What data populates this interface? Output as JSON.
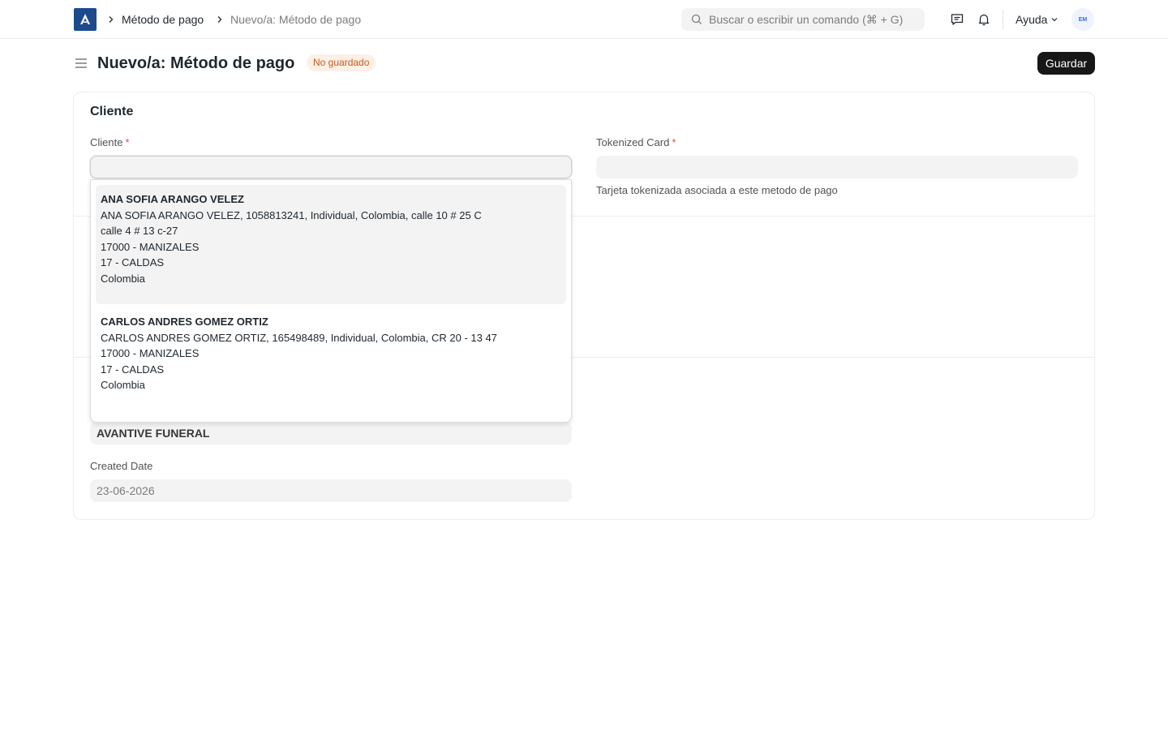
{
  "breadcrumb": {
    "items": [
      "Método de pago",
      "Nuevo/a: Método de pago"
    ]
  },
  "search": {
    "placeholder": "Buscar o escribir un comando (⌘ + G)"
  },
  "navbar": {
    "help_label": "Ayuda",
    "avatar_initials": "EM"
  },
  "page": {
    "title": "Nuevo/a: Método de pago",
    "status_badge": "No guardado",
    "save_label": "Guardar"
  },
  "form": {
    "section_title": "Cliente",
    "cliente": {
      "label": "Cliente",
      "required_mark": "*",
      "value": ""
    },
    "tokenized_card": {
      "label": "Tokenized Card",
      "required_mark": "*",
      "value": "",
      "help": "Tarjeta tokenizada asociada a este metodo de pago"
    },
    "company_value": "AVANTIVE FUNERAL",
    "created_date": {
      "label": "Created Date",
      "value": "23-06-2026"
    }
  },
  "dropdown": {
    "items": [
      {
        "name": "ANA SOFIA ARANGO VELEZ",
        "lines": [
          "ANA SOFIA ARANGO VELEZ, 1058813241, Individual, Colombia, calle 10 # 25 C",
          "calle 4 # 13 c-27",
          "17000 - MANIZALES",
          "17 - CALDAS",
          "Colombia"
        ]
      },
      {
        "name": "CARLOS ANDRES GOMEZ ORTIZ",
        "lines": [
          "CARLOS ANDRES GOMEZ ORTIZ, 165498489, Individual, Colombia, CR 20 - 13 47",
          "17000 - MANIZALES",
          "17 - CALDAS",
          "Colombia"
        ]
      }
    ]
  },
  "colors": {
    "logo": "#1c4a8c",
    "badge_bg": "#fdf0e6",
    "badge_text": "#c8591c",
    "primary_button": "#171717",
    "required": "#e24c4c"
  }
}
